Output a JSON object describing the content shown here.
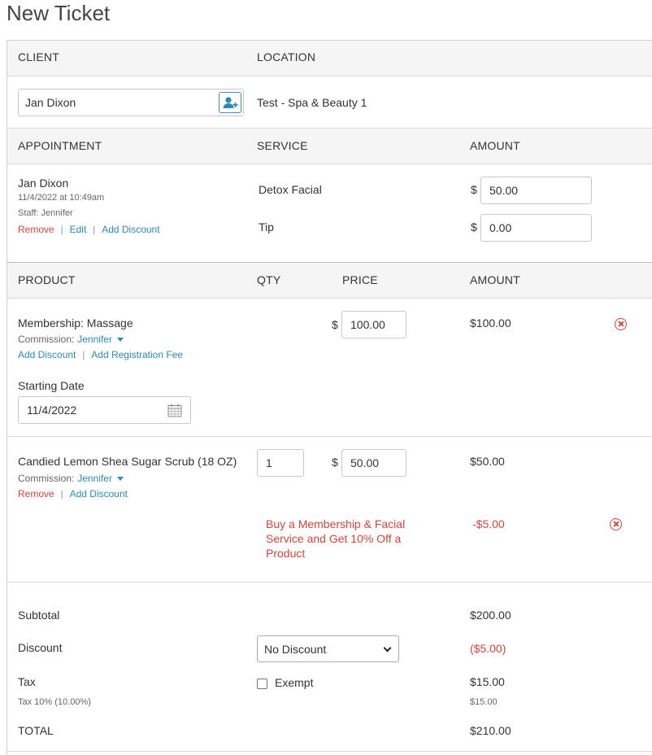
{
  "page": {
    "title": "New Ticket"
  },
  "client_section": {
    "header_client": "CLIENT",
    "header_location": "LOCATION",
    "client_value": "Jan Dixon",
    "location_value": "Test - Spa & Beauty 1"
  },
  "appointment_section": {
    "header_appointment": "APPOINTMENT",
    "header_service": "SERVICE",
    "header_amount": "AMOUNT",
    "client_name": "Jan Dixon",
    "datetime": "11/4/2022 at 10:49am",
    "staff": "Staff: Jennifer",
    "actions": {
      "remove": "Remove",
      "edit": "Edit",
      "add_discount": "Add Discount",
      "sep": "|"
    },
    "service_name": "Detox Facial",
    "service_amount": "50.00",
    "tip_label": "Tip",
    "tip_amount": "0.00",
    "currency": "$"
  },
  "product_section": {
    "header_product": "PRODUCT",
    "header_qty": "QTY",
    "header_price": "PRICE",
    "header_amount": "AMOUNT",
    "items": [
      {
        "name": "Membership: Massage",
        "commission_label": "Commission:",
        "commission_staff": "Jennifer",
        "price": "100.00",
        "amount": "$100.00",
        "actions": {
          "add_discount": "Add Discount",
          "add_registration_fee": "Add Registration Fee"
        },
        "starting_date_label": "Starting Date",
        "starting_date": "11/4/2022"
      },
      {
        "name": "Candied Lemon Shea Sugar Scrub (18 OZ)",
        "commission_label": "Commission:",
        "commission_staff": "Jennifer",
        "qty": "1",
        "price": "50.00",
        "amount": "$50.00",
        "actions": {
          "remove": "Remove",
          "add_discount": "Add Discount"
        },
        "promo_text": "Buy a Membership & Facial Service and Get 10% Off a Product",
        "promo_amount": "-$5.00"
      }
    ]
  },
  "totals": {
    "subtotal_label": "Subtotal",
    "subtotal_value": "$200.00",
    "discount_label": "Discount",
    "discount_select": "No Discount",
    "discount_value": "($5.00)",
    "tax_label": "Tax",
    "tax_exempt_label": "Exempt",
    "tax_value": "$15.00",
    "tax_detail_label": "Tax 10% (10.00%)",
    "tax_detail_value": "$15.00",
    "total_label": "TOTAL",
    "total_value": "$210.00"
  },
  "colors": {
    "link": "#2a8bb5",
    "danger": "#d9443a",
    "header_band": "#f5f5f5"
  },
  "icons": [
    "add-client-icon",
    "calendar-icon",
    "remove-circle-icon",
    "caret-down-icon",
    "chevron-down-icon"
  ]
}
